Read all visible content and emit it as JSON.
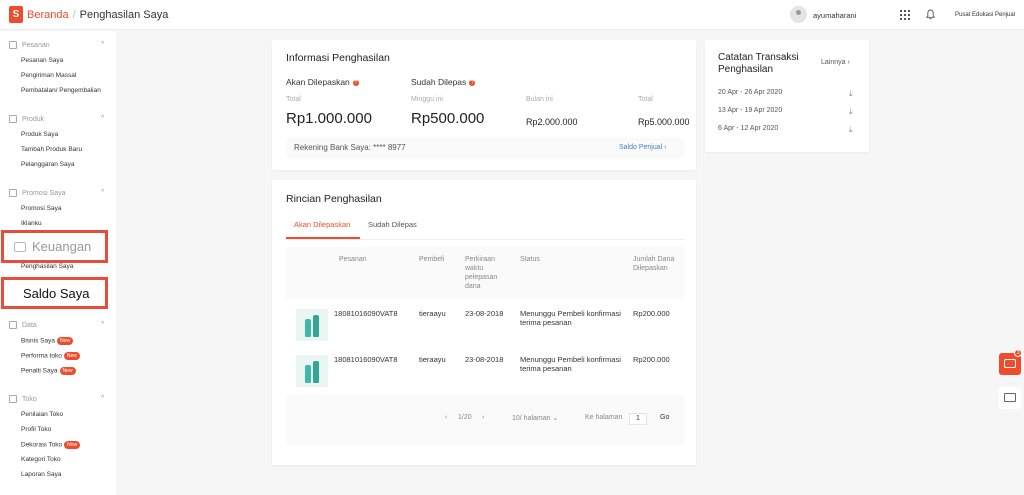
{
  "topbar": {
    "logo_letter": "S",
    "breadcrumb_home": "Beranda",
    "breadcrumb_sep": "/",
    "breadcrumb_current": "Penghasilan Saya",
    "username": "ayumaharani",
    "education": "Pusat Edukasi Penjual"
  },
  "sidebar": {
    "sections": [
      {
        "title": "Pesanan",
        "items": [
          "Pesanan Saya",
          "Pengiriman Massal",
          "Pembatalan/ Pengembalian"
        ]
      },
      {
        "title": "Produk",
        "items": [
          "Produk Saya",
          "Tambah Produk Baru",
          "Pelanggaran Saya"
        ]
      },
      {
        "title": "Promosi Saya",
        "items": [
          "Promosi Saya",
          "Iklanku"
        ]
      },
      {
        "title": "Keuangan",
        "items": [
          "Penghasilan Saya",
          "Saldo Saya"
        ]
      },
      {
        "title": "Data",
        "items": [
          "Bisnis Saya",
          "Performa toko",
          "Penalti Saya"
        ]
      },
      {
        "title": "Toko",
        "items": [
          "Penilaian Toko",
          "Profil Toko",
          "Dekorasi Toko",
          "Kategori Toko",
          "Laporan Saya"
        ]
      }
    ],
    "badge_new": "New",
    "chevron": "^"
  },
  "info": {
    "title": "Informasi Penghasilan",
    "akan_label": "Akan Dilepaskan",
    "sudah_label": "Sudah Dilepas",
    "q": "?",
    "total_label": "Total",
    "total_value": "Rp1.000.000",
    "minggu_label": "Minggu ini",
    "minggu_value": "Rp500.000",
    "bulan_label": "Bulan ini",
    "bulan_value": "Rp2.000.000",
    "total2_label": "Total",
    "total2_value": "Rp5.000.000",
    "bank": "Rekening Bank Saya: **** 8977",
    "saldo_link": "Saldo Penjual"
  },
  "catatan": {
    "title": "Catatan Transaksi Penghasilan",
    "more": "Lainnya",
    "rows": [
      "20 Apr - 26 Apr 2020",
      "13 Apr - 19 Apr 2020",
      "6 Apr - 12 Apr 2020"
    ]
  },
  "rincian": {
    "title": "Rincian Penghasilan",
    "tab_active": "Akan Dilepaskan",
    "tab_other": "Sudah Dilepas",
    "headers": {
      "pesanan": "Pesanan",
      "pembeli": "Pembeli",
      "perkiraan": "Perkiraan waktu pelepasan dana",
      "status": "Status",
      "jumlah": "Jumlah Dana Dilepaskan"
    },
    "rows": [
      {
        "order": "18081016090VAT8",
        "buyer": "tieraayu",
        "date": "23-08-2018",
        "status": "Menunggu Pembeli konfirmasi terima pesanan",
        "amount": "Rp200.000"
      },
      {
        "order": "18081016090VAT8",
        "buyer": "tieraayu",
        "date": "23-08-2018",
        "status": "Menunggu Pembeli konfirmasi terima pesanan",
        "amount": "Rp200.000"
      }
    ],
    "pagination": {
      "prev": "‹",
      "page": "1/20",
      "next": "›",
      "per_page": "10/ halaman",
      "goto_label": "Ke halaman",
      "goto_value": "1",
      "go": "Go"
    }
  },
  "floating": {
    "chat_count": "3"
  },
  "colors": {
    "brand": "#ee4d2d",
    "highlight": "#e74c3c",
    "link": "#4a7cc9"
  }
}
